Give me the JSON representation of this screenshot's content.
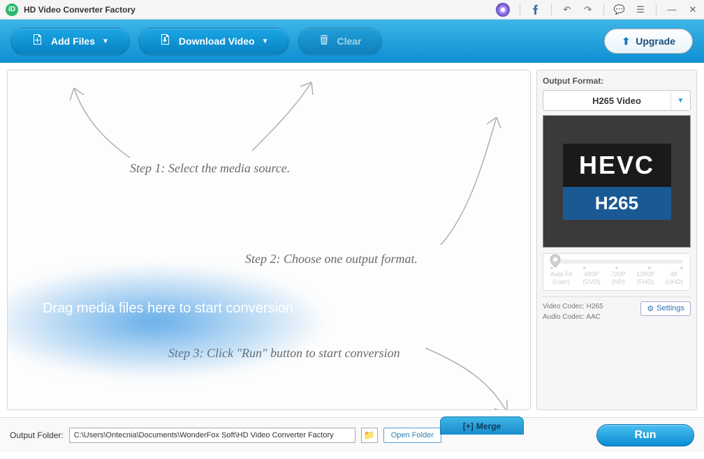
{
  "titlebar": {
    "app_name": "HD Video Converter Factory",
    "logo_text": "iD"
  },
  "toolbar": {
    "add_files": "Add Files",
    "download_video": "Download Video",
    "clear": "Clear",
    "upgrade": "Upgrade"
  },
  "main": {
    "step1": "Step 1: Select the media source.",
    "step2": "Step 2: Choose one output format.",
    "step3": "Step 3: Click \"Run\" button to start conversion",
    "drag_hint": "Drag media files here to start conversion"
  },
  "side": {
    "output_format_label": "Output Format:",
    "format_selected": "H265 Video",
    "hevc_top": "HEVC",
    "hevc_bottom": "H265",
    "resolutions": [
      {
        "t1": "Auto Fit",
        "t2": "(User)"
      },
      {
        "t1": "480P",
        "t2": "(DVD)"
      },
      {
        "t1": "720P",
        "t2": "(HD)"
      },
      {
        "t1": "1080P",
        "t2": "(FHD)"
      },
      {
        "t1": "4K",
        "t2": "(UHD)"
      }
    ],
    "video_codec_label": "Video Codec:",
    "video_codec": "H265",
    "audio_codec_label": "Audio Codec:",
    "audio_codec": "AAC",
    "settings": "Settings"
  },
  "merge": {
    "label": "Merge"
  },
  "footer": {
    "output_folder_label": "Output Folder:",
    "output_path": "C:\\Users\\Ontecnia\\Documents\\WonderFox Soft\\HD Video Converter Factory",
    "open_folder": "Open Folder",
    "run": "Run"
  }
}
